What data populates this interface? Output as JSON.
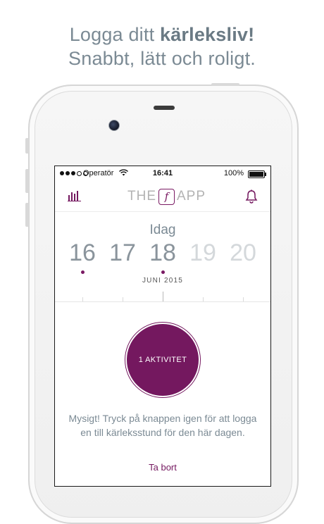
{
  "headline": {
    "line1_prefix": "Logga ditt ",
    "line1_bold": "kärleksliv!",
    "line2": "Snabbt, lätt och roligt."
  },
  "statusbar": {
    "carrier": "Operatör",
    "time": "16:41",
    "battery": "100%"
  },
  "navbar": {
    "logo_left": "THE",
    "logo_mark": "f",
    "logo_right": "APP",
    "left_icon": "bar-chart-icon",
    "right_icon": "bell-icon"
  },
  "calendar": {
    "today_label": "Idag",
    "dates": [
      "16",
      "17",
      "18",
      "19",
      "20"
    ],
    "logged_dates": [
      "16",
      "18"
    ],
    "selected_date": "18",
    "month_label": "JUNI 2015"
  },
  "activity": {
    "button_label": "1 AKTIVITET",
    "message": "Mysigt! Tryck på knappen igen för att logga en till kärleksstund för den här dagen.",
    "remove_label": "Ta bort"
  },
  "colors": {
    "accent": "#74185f",
    "headline": "#7b8a94",
    "muted": "#b3b3b3"
  }
}
